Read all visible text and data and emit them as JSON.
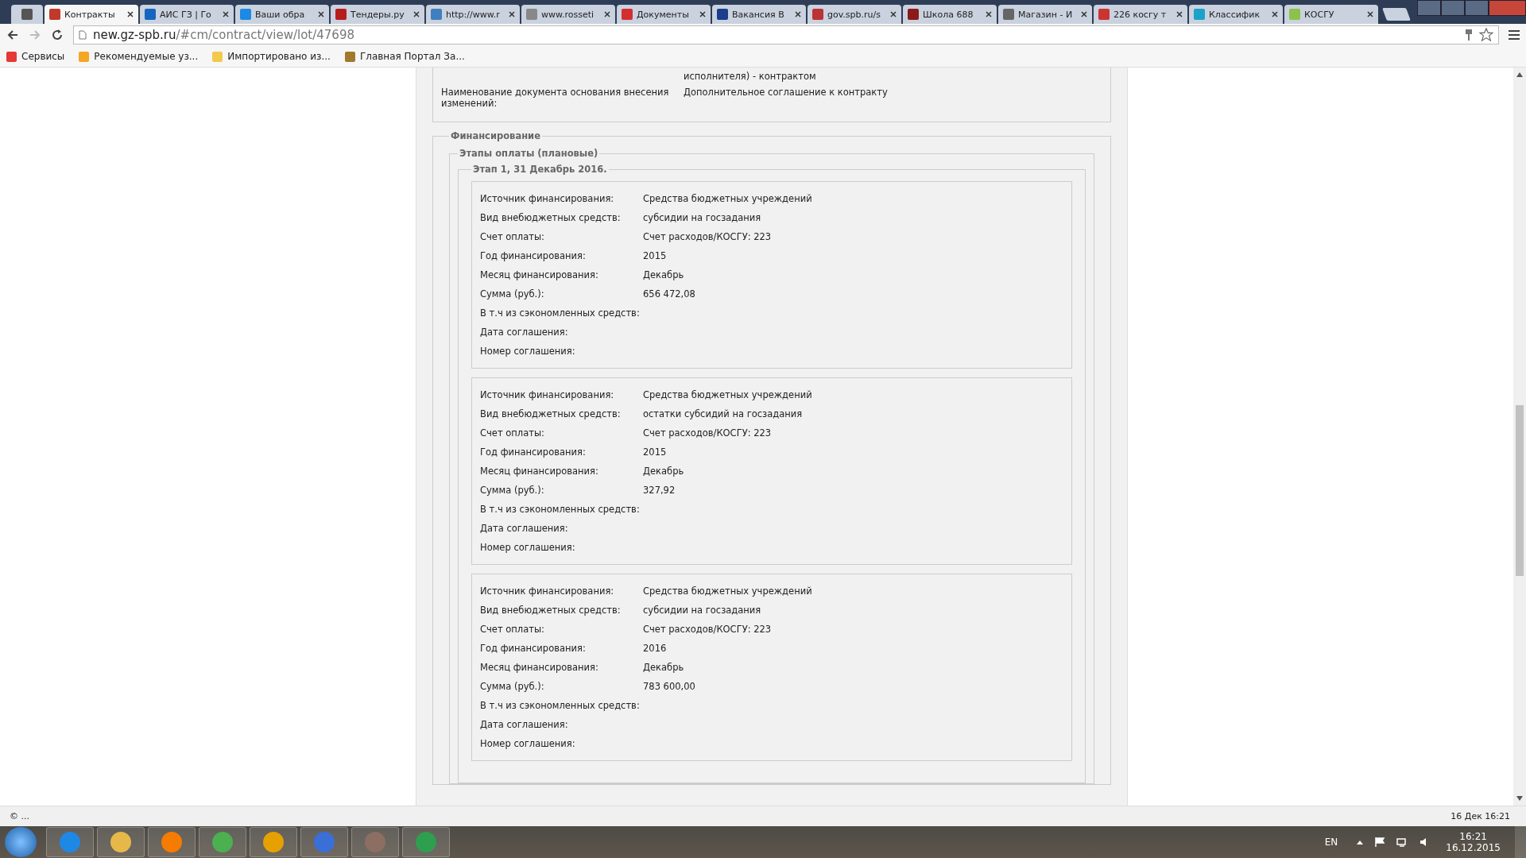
{
  "browser": {
    "tabs": [
      {
        "kind": "pinned",
        "selected": false
      },
      {
        "title": "Контракты",
        "kind": "page",
        "selected": true
      },
      {
        "title": "АИС ГЗ | Го",
        "kind": "page",
        "selected": false
      },
      {
        "title": "Ваши обра",
        "kind": "page",
        "selected": false
      },
      {
        "title": "Тендеры.ру",
        "kind": "page",
        "selected": false
      },
      {
        "title": "http://www.r",
        "kind": "page",
        "selected": false
      },
      {
        "title": "www.rosseti",
        "kind": "page",
        "selected": false
      },
      {
        "title": "Документы",
        "kind": "page",
        "selected": false
      },
      {
        "title": "Вакансия В",
        "kind": "page",
        "selected": false
      },
      {
        "title": "gov.spb.ru/s",
        "kind": "page",
        "selected": false
      },
      {
        "title": "Школа 688",
        "kind": "page",
        "selected": false
      },
      {
        "title": "Магазин - И",
        "kind": "page",
        "selected": false
      },
      {
        "title": "226 косгу т",
        "kind": "page",
        "selected": false
      },
      {
        "title": "Классифик",
        "kind": "page",
        "selected": false
      },
      {
        "title": "КОСГУ",
        "kind": "page",
        "selected": false
      }
    ],
    "address": {
      "domain": "new.gz-spb.ru",
      "path": "/#cm/contract/view/lot/47698"
    },
    "bookmarks": [
      "Сервисы",
      "Рекомендуемые уз...",
      "Импортировано из...",
      "Главная Портал За..."
    ]
  },
  "page": {
    "prev_value_tail": "исполнителя) - контрактом",
    "change_rows": [
      {
        "label": "Наименование документа основания внесения изменений:",
        "value": "Дополнительное соглашение к контракту"
      }
    ],
    "financing": {
      "legend": "Финансирование",
      "stages_legend": "Этапы оплаты (плановые)",
      "stage_legend": "Этап 1, 31 Декабрь 2016.",
      "cards": [
        {
          "rows": [
            {
              "label": "Источник финансирования:",
              "value": "Средства бюджетных учреждений"
            },
            {
              "label": "Вид внебюджетных средств:",
              "value": "субсидии на госзадания"
            },
            {
              "label": "Счет оплаты:",
              "value": "Счет расходов/КОСГУ: 223"
            },
            {
              "label": "Год финансирования:",
              "value": "2015"
            },
            {
              "label": "Месяц финансирования:",
              "value": "Декабрь"
            },
            {
              "label": "Сумма (руб.):",
              "value": "656 472,08"
            },
            {
              "label": "В т.ч из сэкономленных средств:"
            },
            {
              "label": "Дата соглашения:"
            },
            {
              "label": "Номер соглашения:"
            }
          ]
        },
        {
          "rows": [
            {
              "label": "Источник финансирования:",
              "value": "Средства бюджетных учреждений"
            },
            {
              "label": "Вид внебюджетных средств:",
              "value": "остатки субсидий на госзадания"
            },
            {
              "label": "Счет оплаты:",
              "value": "Счет расходов/КОСГУ: 223"
            },
            {
              "label": "Год финансирования:",
              "value": "2015"
            },
            {
              "label": "Месяц финансирования:",
              "value": "Декабрь"
            },
            {
              "label": "Сумма (руб.):",
              "value": "327,92"
            },
            {
              "label": "В т.ч из сэкономленных средств:"
            },
            {
              "label": "Дата соглашения:"
            },
            {
              "label": "Номер соглашения:"
            }
          ]
        },
        {
          "rows": [
            {
              "label": "Источник финансирования:",
              "value": "Средства бюджетных учреждений"
            },
            {
              "label": "Вид внебюджетных средств:",
              "value": "субсидии на госзадания"
            },
            {
              "label": "Счет оплаты:",
              "value": "Счет расходов/КОСГУ: 223"
            },
            {
              "label": "Год финансирования:",
              "value": "2016"
            },
            {
              "label": "Месяц финансирования:",
              "value": "Декабрь"
            },
            {
              "label": "Сумма (руб.):",
              "value": "783 600,00"
            },
            {
              "label": "В т.ч из сэкономленных средств:"
            },
            {
              "label": "Дата соглашения:"
            },
            {
              "label": "Номер соглашения:"
            }
          ]
        }
      ]
    }
  },
  "status_bar": {
    "left": "© ...",
    "right": "16 Дек 16:21"
  },
  "taskbar": {
    "language": "EN",
    "time": "16:21",
    "date": "16.12.2015"
  }
}
